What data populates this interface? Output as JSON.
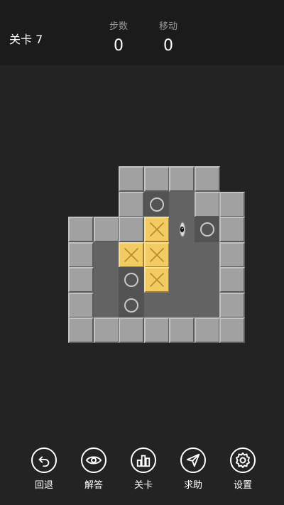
{
  "header": {
    "level": "关卡 7",
    "steps_label": "步数",
    "steps_value": "0",
    "moves_label": "移动",
    "moves_value": "0"
  },
  "level": {
    "map": [
      "  ####",
      "  #. ##",
      "###B@.#",
      "# BB  #",
      "# .B  #",
      "# .   #",
      "#######"
    ],
    "legend": {
      "#": "wall",
      " ": "floor",
      ".": "target",
      "B": "box",
      "@": "player"
    },
    "colors": {
      "wall": "#a1a1a1",
      "floor": "#636363",
      "box": "#f2cc62",
      "background": "#232324"
    }
  },
  "toolbar": [
    {
      "icon": "undo-icon",
      "label": "回退"
    },
    {
      "icon": "eye-icon",
      "label": "解答"
    },
    {
      "icon": "level-select-icon",
      "label": "关卡"
    },
    {
      "icon": "send-icon",
      "label": "求助"
    },
    {
      "icon": "gear-icon",
      "label": "设置"
    }
  ]
}
